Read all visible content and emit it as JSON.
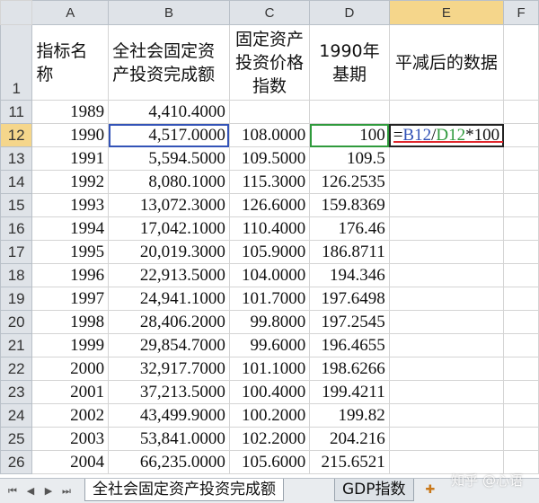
{
  "columns": [
    "A",
    "B",
    "C",
    "D",
    "E",
    "F"
  ],
  "header_row": {
    "row_number": "1",
    "a": "指标名称",
    "b": "全社会固定资产投资完成额",
    "c": "固定资产投资价格指数",
    "d": "1990年基期",
    "e": "平减后的数据"
  },
  "rows": [
    {
      "n": "11",
      "a": "1989",
      "b": "4,410.4000",
      "c": "",
      "d": ""
    },
    {
      "n": "12",
      "a": "1990",
      "b": "4,517.0000",
      "c": "108.0000",
      "d": "100"
    },
    {
      "n": "13",
      "a": "1991",
      "b": "5,594.5000",
      "c": "109.5000",
      "d": "109.5"
    },
    {
      "n": "14",
      "a": "1992",
      "b": "8,080.1000",
      "c": "115.3000",
      "d": "126.2535"
    },
    {
      "n": "15",
      "a": "1993",
      "b": "13,072.3000",
      "c": "126.6000",
      "d": "159.8369"
    },
    {
      "n": "16",
      "a": "1994",
      "b": "17,042.1000",
      "c": "110.4000",
      "d": "176.46"
    },
    {
      "n": "17",
      "a": "1995",
      "b": "20,019.3000",
      "c": "105.9000",
      "d": "186.8711"
    },
    {
      "n": "18",
      "a": "1996",
      "b": "22,913.5000",
      "c": "104.0000",
      "d": "194.346"
    },
    {
      "n": "19",
      "a": "1997",
      "b": "24,941.1000",
      "c": "101.7000",
      "d": "197.6498"
    },
    {
      "n": "20",
      "a": "1998",
      "b": "28,406.2000",
      "c": "99.8000",
      "d": "197.2545"
    },
    {
      "n": "21",
      "a": "1999",
      "b": "29,854.7000",
      "c": "99.6000",
      "d": "196.4655"
    },
    {
      "n": "22",
      "a": "2000",
      "b": "32,917.7000",
      "c": "101.1000",
      "d": "198.6266"
    },
    {
      "n": "23",
      "a": "2001",
      "b": "37,213.5000",
      "c": "100.4000",
      "d": "199.4211"
    },
    {
      "n": "24",
      "a": "2002",
      "b": "43,499.9000",
      "c": "100.2000",
      "d": "199.82"
    },
    {
      "n": "25",
      "a": "2003",
      "b": "53,841.0000",
      "c": "102.2000",
      "d": "204.216"
    },
    {
      "n": "26",
      "a": "2004",
      "b": "66,235.0000",
      "c": "105.6000",
      "d": "215.6521"
    }
  ],
  "formula": {
    "eq": "=",
    "ref1": "B12",
    "div": "/",
    "ref2": "D12",
    "tail": "*100"
  },
  "tabs": {
    "sheet1": "全社会固定资产投资完成额",
    "sheet2": "GDP指数"
  },
  "watermark": "知乎 @心语",
  "colors": {
    "ref1": "#3353b7",
    "ref2": "#2f9a3c",
    "underline": "#e0262c"
  }
}
